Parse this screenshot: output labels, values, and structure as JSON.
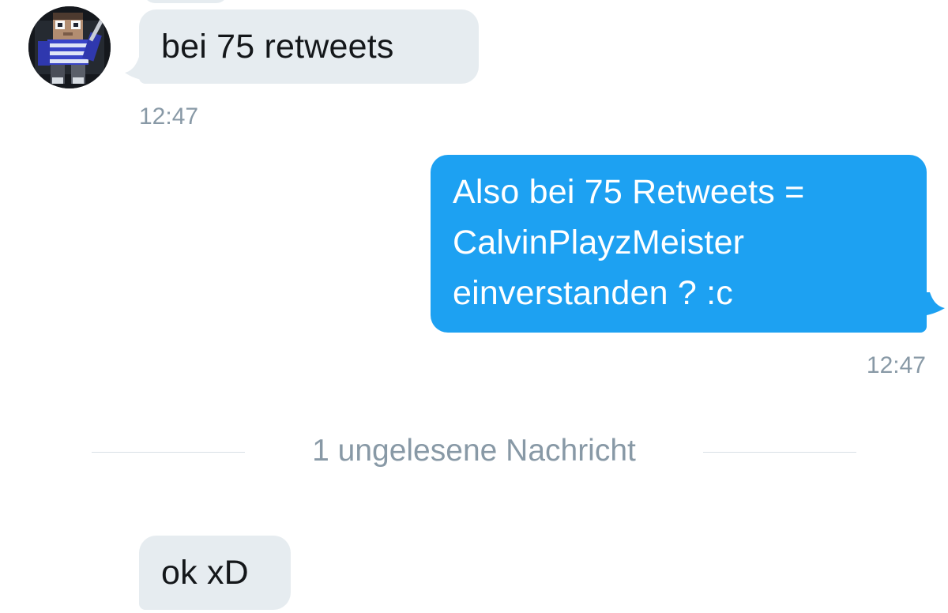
{
  "conversation": {
    "messages": [
      {
        "sender": "incoming",
        "text": "bei 75 retweets",
        "time": "12:47"
      },
      {
        "sender": "outgoing",
        "lines": [
          "Also bei 75 Retweets =",
          "CalvinPlayzMeister",
          "einverstanden ? :c"
        ],
        "time": "12:47"
      },
      {
        "sender": "incoming",
        "text": "ok xD"
      }
    ],
    "unread_divider": {
      "label": "1 ungelesene Nachricht"
    }
  },
  "colors": {
    "incoming_bubble": "#e6ecf0",
    "outgoing_bubble": "#1da1f2",
    "timestamp": "#8899a6"
  },
  "icons": {
    "avatar": "minecraft-character-avatar-icon"
  }
}
